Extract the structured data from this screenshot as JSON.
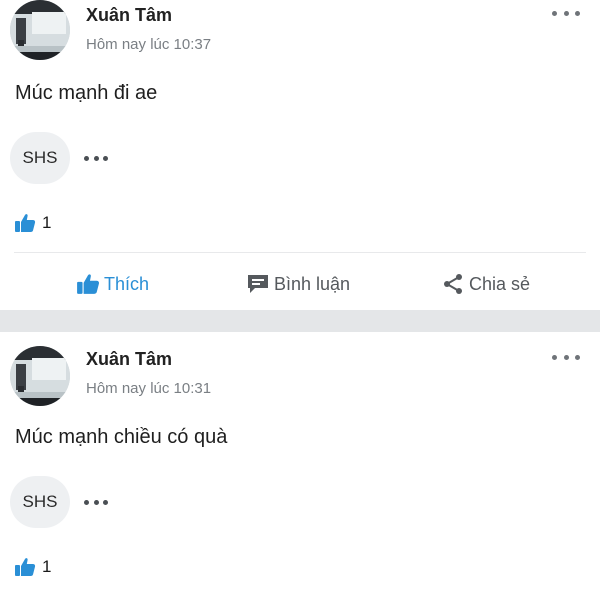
{
  "posts": [
    {
      "author": "Xuân Tâm",
      "time": "Hôm nay lúc 10:37",
      "text": "Múc mạnh đi ae",
      "attachment_label": "SHS",
      "like_count": "1"
    },
    {
      "author": "Xuân Tâm",
      "time": "Hôm nay lúc 10:31",
      "text": "Múc mạnh chiều có quà",
      "attachment_label": "SHS",
      "like_count": "1"
    }
  ],
  "actions": {
    "like_label": "Thích",
    "comment_label": "Bình luận",
    "share_label": "Chia sẻ"
  },
  "colors": {
    "accent": "#2a8fd6",
    "divider": "#e4e6e8",
    "muted_text": "#7a7f84"
  },
  "icons": {
    "like": "thumbs-up-icon",
    "comment": "comment-icon",
    "share": "share-icon",
    "more": "more-dots-icon"
  }
}
